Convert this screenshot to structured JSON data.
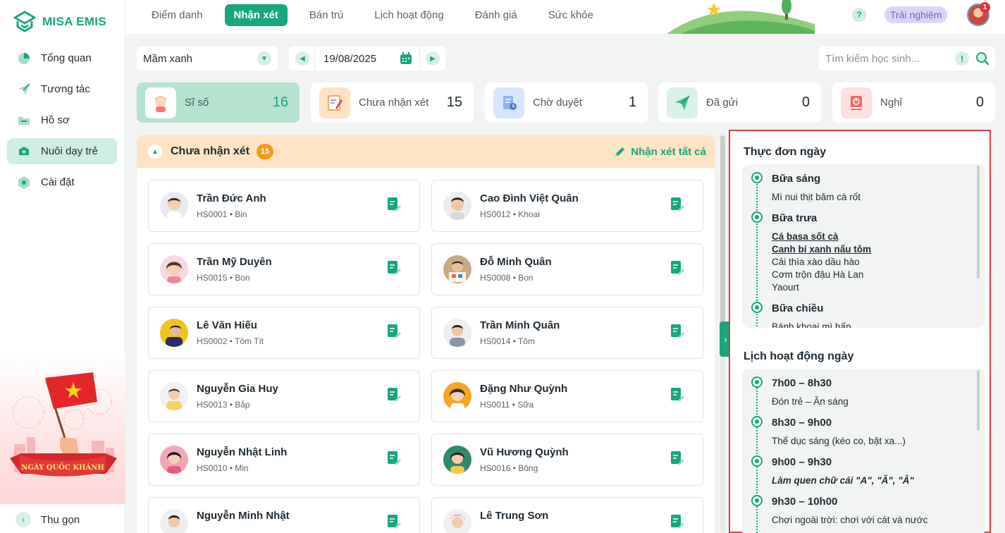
{
  "app": {
    "logo_text": "MISA EMIS"
  },
  "sidebar": {
    "items": [
      {
        "label": "Tổng quan",
        "icon": "pie-chart-icon",
        "active": false
      },
      {
        "label": "Tương tác",
        "icon": "paper-plane-icon",
        "active": false
      },
      {
        "label": "Hồ sơ",
        "icon": "folder-icon",
        "active": false
      },
      {
        "label": "Nuôi dạy trẻ",
        "icon": "heart-icon",
        "active": true
      },
      {
        "label": "Cài đặt",
        "icon": "gear-icon",
        "active": false
      }
    ],
    "promo_text": "NGÀY QUỐC KHÁNH",
    "collapse_label": "Thu gọn"
  },
  "topbar": {
    "tabs": [
      "Điểm danh",
      "Nhận xét",
      "Bán trú",
      "Lịch hoạt động",
      "Đánh giá",
      "Sức khỏe"
    ],
    "active_tab": "Nhận xét",
    "help": "?",
    "trial_label": "Trải nghiệm",
    "notification_count": "1"
  },
  "filters": {
    "class_value": "Mầm xanh",
    "date_value": "19/08/2025",
    "search_placeholder": "Tìm kiếm học sinh..."
  },
  "stats": [
    {
      "label": "Sĩ số",
      "value": "16",
      "icon": "student-icon",
      "active": true
    },
    {
      "label": "Chưa nhận xét",
      "value": "15",
      "icon": "clipboard-pen-icon",
      "active": false
    },
    {
      "label": "Chờ duyệt",
      "value": "1",
      "icon": "document-pending-icon",
      "active": false
    },
    {
      "label": "Đã gửi",
      "value": "0",
      "icon": "send-icon",
      "active": false
    },
    {
      "label": "Nghỉ",
      "value": "0",
      "icon": "power-book-icon",
      "active": false
    }
  ],
  "section": {
    "title": "Chưa nhận xét",
    "count": "15",
    "action_label": "Nhận xét tất cả"
  },
  "students": [
    {
      "name": "Trần Đức Anh",
      "sub": "HS0001 • Bin"
    },
    {
      "name": "Cao Đình Việt Quân",
      "sub": "HS0012 • Khoai"
    },
    {
      "name": "Trần Mỹ Duyên",
      "sub": "HS0015 • Bon"
    },
    {
      "name": "Đỗ Minh Quân",
      "sub": "HS0008 • Bon"
    },
    {
      "name": "Lê Văn Hiếu",
      "sub": "HS0002 • Tôm Tít"
    },
    {
      "name": "Trần Minh Quân",
      "sub": "HS0014 • Tôm"
    },
    {
      "name": "Nguyễn Gia Huy",
      "sub": "HS0013 • Bắp"
    },
    {
      "name": "Đặng Như Quỳnh",
      "sub": "HS0011 • Sữa"
    },
    {
      "name": "Nguyễn Nhật Linh",
      "sub": "HS0010 • Min"
    },
    {
      "name": "Vũ Hương Quỳnh",
      "sub": "HS0016 • Bông"
    },
    {
      "name": "Nguyễn Minh Nhật",
      "sub": ""
    },
    {
      "name": "Lê Trung Sơn",
      "sub": ""
    }
  ],
  "menu": {
    "title": "Thực đơn ngày",
    "meals": [
      {
        "name": "Bữa sáng",
        "dishes": [
          "Mì nui thịt băm cà rốt"
        ]
      },
      {
        "name": "Bữa trưa",
        "dishes": [
          "Cá basa sốt cà",
          "Canh bí xanh nấu tôm",
          "Cải thìa xào dầu hào",
          "Cơm trộn đậu Hà Lan",
          "Yaourt"
        ]
      },
      {
        "name": "Bữa chiều",
        "dishes": [
          "Bánh khoai mì hấp"
        ]
      }
    ]
  },
  "schedule": {
    "title": "Lịch hoạt động ngày",
    "items": [
      {
        "time": "7h00 – 8h30",
        "activity": "Đón trẻ – Ăn sáng"
      },
      {
        "time": "8h30 – 9h00",
        "activity": "Thể dục sáng (kéo co, bật xa...)"
      },
      {
        "time": "9h00 – 9h30",
        "activity": "Làm quen chữ cái \"A\", \"Ă\", \"Â\""
      },
      {
        "time": "9h30 – 10h00",
        "activity": "Chơi ngoài trời: chơi với cát và nước"
      }
    ]
  },
  "colors": {
    "accent": "#17a67d",
    "highlight": "#e03a3a",
    "orange": "#f59a1b"
  }
}
